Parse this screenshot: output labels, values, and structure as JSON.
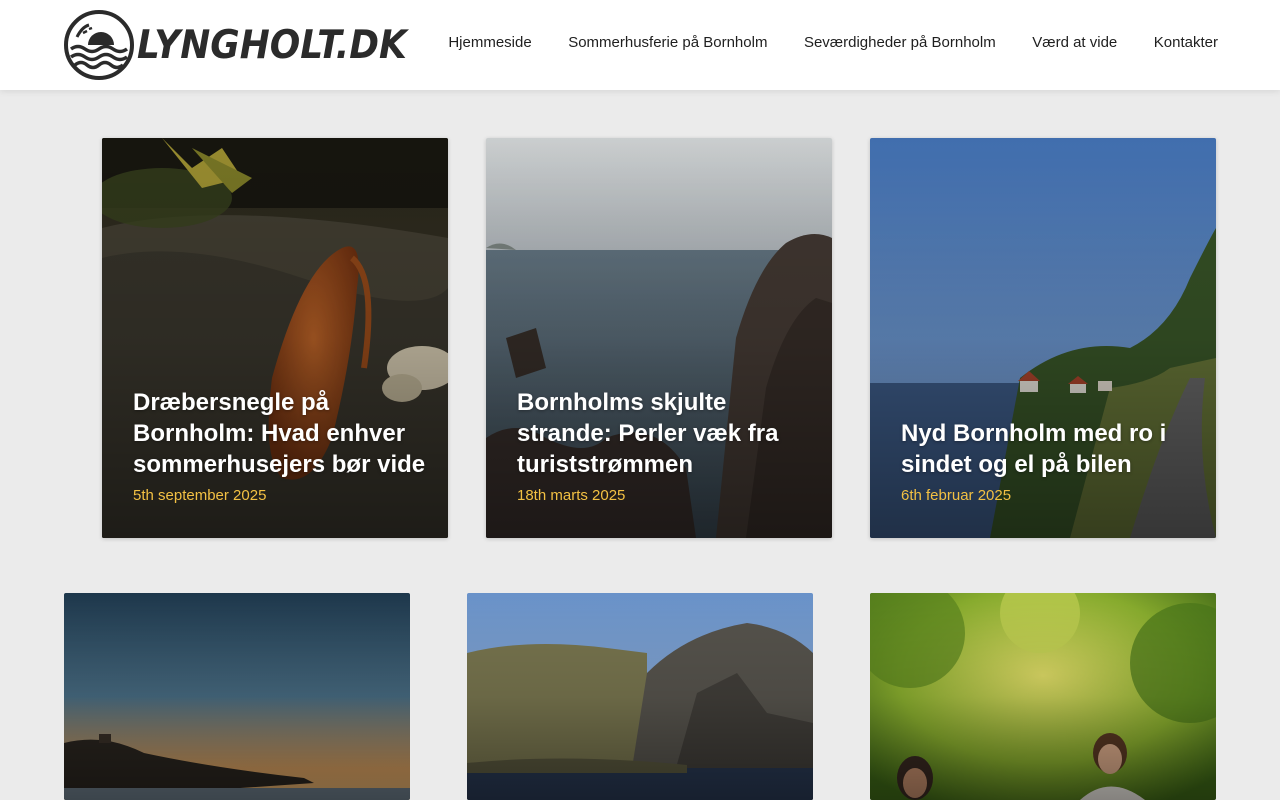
{
  "site": {
    "logo_text": "LYNGHOLT.DK"
  },
  "nav": {
    "items": [
      {
        "label": "Hjemmeside"
      },
      {
        "label": "Sommerhusferie på Bornholm"
      },
      {
        "label": "Seværdigheder på Bornholm"
      },
      {
        "label": "Værd at vide"
      },
      {
        "label": "Kontakter"
      }
    ]
  },
  "posts": [
    {
      "title": "Dræbersnegle på Bornholm: Hvad enhver sommerhusejers bør vide",
      "date": "5th september 2025",
      "image": "slug-on-mossy-log"
    },
    {
      "title": "Bornholms skjulte strande: Perler væk fra turiststrømmen",
      "date": "18th marts 2025",
      "image": "rocky-coast-sea"
    },
    {
      "title": "Nyd Bornholm med ro i sindet og el på bilen",
      "date": "6th februar 2025",
      "image": "coastal-road-village"
    },
    {
      "title": "",
      "date": "",
      "image": "sunset-coastline"
    },
    {
      "title": "",
      "date": "",
      "image": "cliff-quarry-lake"
    },
    {
      "title": "",
      "date": "",
      "image": "women-in-forest"
    }
  ],
  "colors": {
    "accent_date": "#f2c043",
    "background": "#ebebeb",
    "header": "#ffffff"
  }
}
